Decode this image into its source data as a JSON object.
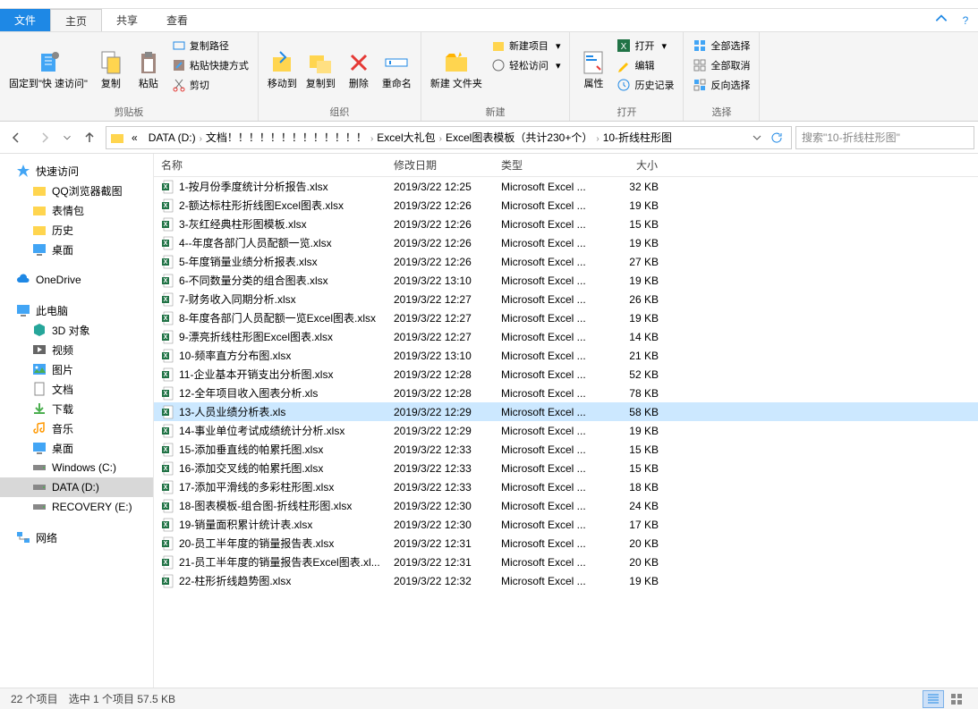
{
  "tabs": {
    "file": "文件",
    "home": "主页",
    "share": "共享",
    "view": "查看"
  },
  "ribbon": {
    "pin_label": "固定到\"快\n速访问\"",
    "copy_label": "复制",
    "paste_label": "粘贴",
    "copy_path": "复制路径",
    "paste_shortcut": "粘贴快捷方式",
    "cut": "剪切",
    "group_clipboard": "剪贴板",
    "moveto_label": "移动到",
    "copyto_label": "复制到",
    "delete_label": "删除",
    "rename_label": "重命名",
    "group_organize": "组织",
    "newfolder_label": "新建\n文件夹",
    "newitem": "新建项目",
    "easyaccess": "轻松访问",
    "group_new": "新建",
    "properties_label": "属性",
    "open": "打开",
    "edit": "编辑",
    "history": "历史记录",
    "group_open": "打开",
    "selectall": "全部选择",
    "selectnone": "全部取消",
    "invert": "反向选择",
    "group_select": "选择"
  },
  "breadcrumb": {
    "prefix": "«",
    "items": [
      "DATA (D:)",
      "文档！！！！！！！！！！！！！",
      "Excel大礼包",
      "Excel图表模板（共计230+个）",
      "10-折线柱形图"
    ]
  },
  "search_placeholder": "搜索\"10-折线柱形图\"",
  "sidebar": {
    "quick": "快速访问",
    "qq": "QQ浏览器截图",
    "emoji": "表情包",
    "history": "历史",
    "desktop": "桌面",
    "onedrive": "OneDrive",
    "thispc": "此电脑",
    "3d": "3D 对象",
    "video": "视频",
    "pictures": "图片",
    "docs": "文档",
    "downloads": "下载",
    "music": "音乐",
    "desktop2": "桌面",
    "cdrive": "Windows (C:)",
    "ddrive": "DATA (D:)",
    "recovery": "RECOVERY (E:)",
    "network": "网络"
  },
  "columns": {
    "name": "名称",
    "date": "修改日期",
    "type": "类型",
    "size": "大小"
  },
  "files": [
    {
      "name": "1-按月份季度统计分析报告.xlsx",
      "date": "2019/3/22 12:25",
      "type": "Microsoft Excel ...",
      "size": "32 KB"
    },
    {
      "name": "2-额达标柱形折线图Excel图表.xlsx",
      "date": "2019/3/22 12:26",
      "type": "Microsoft Excel ...",
      "size": "19 KB"
    },
    {
      "name": "3-灰红经典柱形图模板.xlsx",
      "date": "2019/3/22 12:26",
      "type": "Microsoft Excel ...",
      "size": "15 KB"
    },
    {
      "name": "4--年度各部门人员配额一览.xlsx",
      "date": "2019/3/22 12:26",
      "type": "Microsoft Excel ...",
      "size": "19 KB"
    },
    {
      "name": "5-年度销量业绩分析报表.xlsx",
      "date": "2019/3/22 12:26",
      "type": "Microsoft Excel ...",
      "size": "27 KB"
    },
    {
      "name": "6-不同数量分类的组合图表.xlsx",
      "date": "2019/3/22 13:10",
      "type": "Microsoft Excel ...",
      "size": "19 KB"
    },
    {
      "name": "7-财务收入同期分析.xlsx",
      "date": "2019/3/22 12:27",
      "type": "Microsoft Excel ...",
      "size": "26 KB"
    },
    {
      "name": "8-年度各部门人员配额一览Excel图表.xlsx",
      "date": "2019/3/22 12:27",
      "type": "Microsoft Excel ...",
      "size": "19 KB"
    },
    {
      "name": "9-漂亮折线柱形图Excel图表.xlsx",
      "date": "2019/3/22 12:27",
      "type": "Microsoft Excel ...",
      "size": "14 KB"
    },
    {
      "name": "10-频率直方分布图.xlsx",
      "date": "2019/3/22 13:10",
      "type": "Microsoft Excel ...",
      "size": "21 KB"
    },
    {
      "name": "11-企业基本开销支出分析图.xlsx",
      "date": "2019/3/22 12:28",
      "type": "Microsoft Excel ...",
      "size": "52 KB"
    },
    {
      "name": "12-全年项目收入图表分析.xls",
      "date": "2019/3/22 12:28",
      "type": "Microsoft Excel ...",
      "size": "78 KB"
    },
    {
      "name": "13-人员业绩分析表.xls",
      "date": "2019/3/22 12:29",
      "type": "Microsoft Excel ...",
      "size": "58 KB",
      "selected": true
    },
    {
      "name": "14-事业单位考试成绩统计分析.xlsx",
      "date": "2019/3/22 12:29",
      "type": "Microsoft Excel ...",
      "size": "19 KB"
    },
    {
      "name": "15-添加垂直线的帕累托图.xlsx",
      "date": "2019/3/22 12:33",
      "type": "Microsoft Excel ...",
      "size": "15 KB"
    },
    {
      "name": "16-添加交叉线的帕累托图.xlsx",
      "date": "2019/3/22 12:33",
      "type": "Microsoft Excel ...",
      "size": "15 KB"
    },
    {
      "name": "17-添加平滑线的多彩柱形图.xlsx",
      "date": "2019/3/22 12:33",
      "type": "Microsoft Excel ...",
      "size": "18 KB"
    },
    {
      "name": "18-图表模板-组合图-折线柱形图.xlsx",
      "date": "2019/3/22 12:30",
      "type": "Microsoft Excel ...",
      "size": "24 KB"
    },
    {
      "name": "19-销量面积累计统计表.xlsx",
      "date": "2019/3/22 12:30",
      "type": "Microsoft Excel ...",
      "size": "17 KB"
    },
    {
      "name": "20-员工半年度的销量报告表.xlsx",
      "date": "2019/3/22 12:31",
      "type": "Microsoft Excel ...",
      "size": "20 KB"
    },
    {
      "name": "21-员工半年度的销量报告表Excel图表.xl...",
      "date": "2019/3/22 12:31",
      "type": "Microsoft Excel ...",
      "size": "20 KB"
    },
    {
      "name": "22-柱形折线趋势图.xlsx",
      "date": "2019/3/22 12:32",
      "type": "Microsoft Excel ...",
      "size": "19 KB"
    }
  ],
  "status": {
    "count": "22 个项目",
    "selected": "选中 1 个项目  57.5 KB"
  }
}
